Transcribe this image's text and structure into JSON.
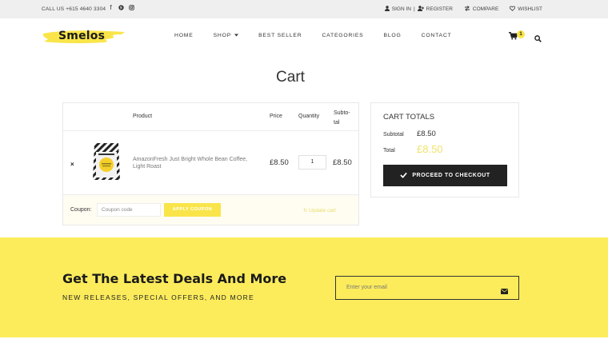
{
  "topbar": {
    "phone": "CALL US +615 4640 3304",
    "social_icons": [
      "facebook-icon",
      "pinterest-icon",
      "instagram-icon"
    ],
    "links": [
      {
        "icon": "user-icon",
        "label": "SIGN IN"
      },
      {
        "icon": "user-plus-icon",
        "label": "REGISTER"
      },
      {
        "icon": "compare-icon",
        "label": "COMPARE"
      },
      {
        "icon": "heart-icon",
        "label": "WISHLIST"
      }
    ],
    "separator": "|"
  },
  "header": {
    "logo": "Smelos",
    "nav": [
      "HOME",
      "SHOP",
      "BEST SELLER",
      "CATEGORIES",
      "BLOG",
      "CONTACT"
    ],
    "cart_count": "1"
  },
  "page_title": "Cart",
  "cart_table": {
    "headers": {
      "product": "Product",
      "price": "Price",
      "quantity": "Quantity",
      "subtotal": "Subto-\ntal"
    },
    "rows": [
      {
        "remove": "×",
        "name": "AmazonFresh Just Bright Whole Bean Coffee, Light Roast",
        "price": "£8.50",
        "quantity": "1",
        "subtotal": "£8.50"
      }
    ],
    "coupon_label": "Coupon:",
    "coupon_placeholder": "Coupon code",
    "apply_label": "APPLY COUPON",
    "update_label": "↻ Update cart"
  },
  "totals": {
    "title": "CART TOTALS",
    "subtotal_label": "Subtotal",
    "subtotal_value": "£8.50",
    "total_label": "Total",
    "total_value": "£8.50",
    "checkout_label": "PROCEED TO CHECKOUT"
  },
  "newsletter": {
    "title": "Get The Latest Deals And More",
    "subtitle": "NEW RELEASES, SPECIAL OFFERS, AND MORE",
    "email_placeholder": "Enter your email"
  },
  "colors": {
    "accent_yellow": "#fcec5c",
    "dark": "#222222",
    "topbar_bg": "#efefef"
  }
}
